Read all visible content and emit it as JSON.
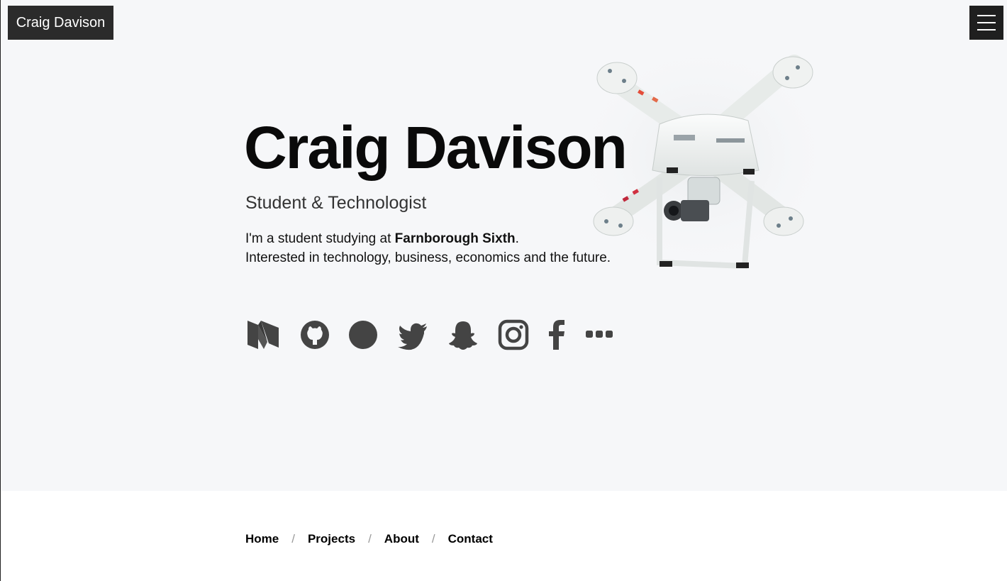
{
  "brand": {
    "label": "Craig Davison"
  },
  "menu": {
    "icon": "hamburger-icon"
  },
  "hero": {
    "title": "Craig Davison",
    "subtitle": "Student & Technologist",
    "bio_line1_prefix": "I'm a student studying at ",
    "bio_line1_bold": "Farnborough Sixth",
    "bio_line1_suffix": ".",
    "bio_line2": "Interested in technology, business, economics and the future.",
    "image": "drone-photo"
  },
  "social": [
    {
      "name": "medium-icon"
    },
    {
      "name": "github-icon"
    },
    {
      "name": "circle-icon"
    },
    {
      "name": "twitter-icon"
    },
    {
      "name": "snapchat-icon"
    },
    {
      "name": "instagram-icon"
    },
    {
      "name": "facebook-icon"
    },
    {
      "name": "more-icon"
    }
  ],
  "footer_nav": {
    "items": [
      "Home",
      "Projects",
      "About",
      "Contact"
    ],
    "separator": "/"
  },
  "colors": {
    "hero_bg": "#f6f7f9",
    "brand_bg": "#2b2b2b",
    "icon": "#444444"
  }
}
